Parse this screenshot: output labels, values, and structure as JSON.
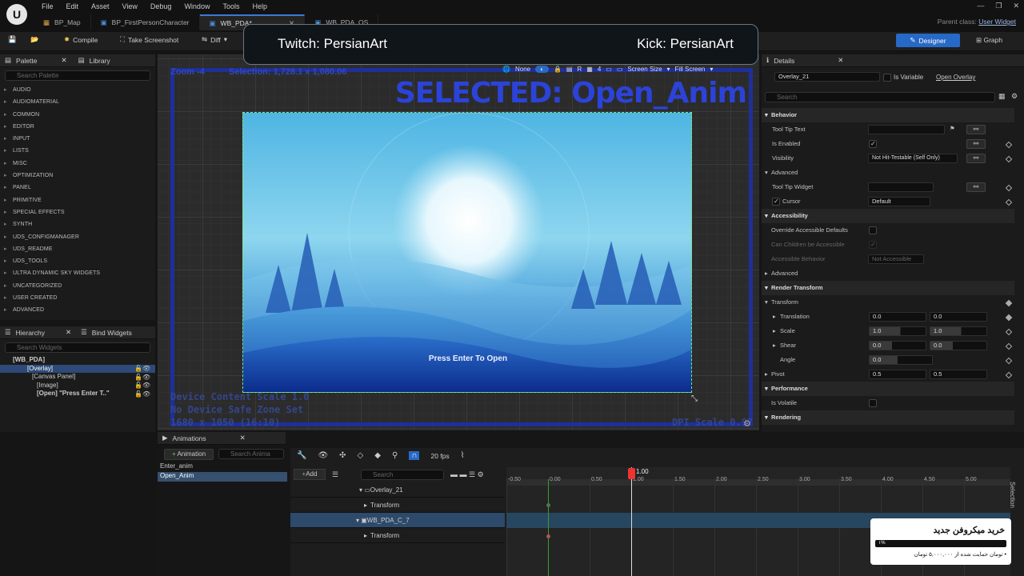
{
  "menu": [
    "File",
    "Edit",
    "Asset",
    "View",
    "Debug",
    "Window",
    "Tools",
    "Help"
  ],
  "tabs": [
    {
      "label": "BP_Map"
    },
    {
      "label": "BP_FirstPersonCharacter"
    },
    {
      "label": "WB_PDA*"
    },
    {
      "label": "WB_PDA_OS"
    }
  ],
  "parent_class": {
    "label": "Parent class:",
    "value": "User Widget"
  },
  "toolbar": {
    "compile": "Compile",
    "screenshot": "Take Screenshot",
    "diff": "Diff",
    "designer": "Designer",
    "graph": "Graph"
  },
  "stream": {
    "twitch": "Twitch: PersianArt",
    "kick": "Kick: PersianArt"
  },
  "palette": {
    "tab": "Palette",
    "library": "Library",
    "search": "Search Palette",
    "categories": [
      "AUDIO",
      "AUDIOMATERIAL",
      "COMMON",
      "EDITOR",
      "INPUT",
      "LISTS",
      "MISC",
      "OPTIMIZATION",
      "PANEL",
      "PRIMITIVE",
      "SPECIAL EFFECTS",
      "SYNTH",
      "UDS_CONFIGMANAGER",
      "UDS_README",
      "UDS_TOOLS",
      "ULTRA DYNAMIC SKY WIDGETS",
      "UNCATEGORIZED",
      "USER CREATED",
      "ADVANCED"
    ]
  },
  "hierarchy": {
    "tab": "Hierarchy",
    "bind": "Bind Widgets",
    "search": "Search Widgets",
    "items": [
      "[WB_PDA]",
      "[Overlay]",
      "[Canvas Panel]",
      "[Image]",
      "[Open] \"Press Enter T..\""
    ]
  },
  "viewport": {
    "zoom": "Zoom -4",
    "selection": "Selection: 1,728.1 x 1,080.06",
    "selected": "SELECTED: Open_Anim",
    "none": "None",
    "r": "R",
    "four": "4",
    "screen_size": "Screen Size",
    "fill_screen": "Fill Screen",
    "device_scale": "Device Content Scale 1.0",
    "safe_zone": "No Device Safe Zone Set",
    "resolution": "1680 x 1050 (16:10)",
    "dpi": "DPI Scale 0.97",
    "press_enter": "Press Enter To Open"
  },
  "details": {
    "tab": "Details",
    "name": "Overlay_21",
    "is_variable": "Is Variable",
    "open_overlay": "Open Overlay",
    "search": "Search",
    "behavior": "Behavior",
    "tooltip_text": "Tool Tip Text",
    "is_enabled": "Is Enabled",
    "visibility": "Visibility",
    "visibility_value": "Not Hit-Testable (Self Only)",
    "advanced": "Advanced",
    "tooltip_widget": "Tool Tip Widget",
    "cursor": "Cursor",
    "cursor_value": "Default",
    "accessibility": "Accessibility",
    "override_access": "Override Accessible Defaults",
    "can_children": "Can Children be Accessible",
    "access_behavior": "Accessible Behavior",
    "access_value": "Not Accessible",
    "advanced2": "Advanced",
    "render_transform": "Render Transform",
    "transform": "Transform",
    "translation": "Translation",
    "t_x": "0.0",
    "t_y": "0.0",
    "scale": "Scale",
    "s_x": "1.0",
    "s_y": "1.0",
    "shear": "Shear",
    "sh_x": "0.0",
    "sh_y": "0.0",
    "angle": "Angle",
    "angle_v": "0.0",
    "pivot": "Pivot",
    "p_x": "0.5",
    "p_y": "0.5",
    "performance": "Performance",
    "is_volatile": "Is Volatile",
    "rendering": "Rendering"
  },
  "animations": {
    "tab": "Animations",
    "add": "Animation",
    "search": "Search Anima",
    "list": [
      "Enter_anim",
      "Open_Anim"
    ]
  },
  "sequencer": {
    "add": "Add",
    "search": "Search",
    "fps": "20 fps",
    "playhead": "1.00",
    "selection": "Selection",
    "tracks": [
      "Overlay_21",
      "Transform",
      "WB_PDA_C_7",
      "Transform"
    ],
    "ticks": [
      "-0.50",
      "0.00",
      "0.50",
      "1.00",
      "1.50",
      "2.00",
      "2.50",
      "3.00",
      "3.50",
      "4.00",
      "4.50",
      "5.00"
    ]
  },
  "popup": {
    "title": "خرید میکروفن جدید",
    "sub": "• تومان حمایت شده از ۵,۰۰۰,۰۰۰ تومان",
    "bar": "۱%"
  }
}
